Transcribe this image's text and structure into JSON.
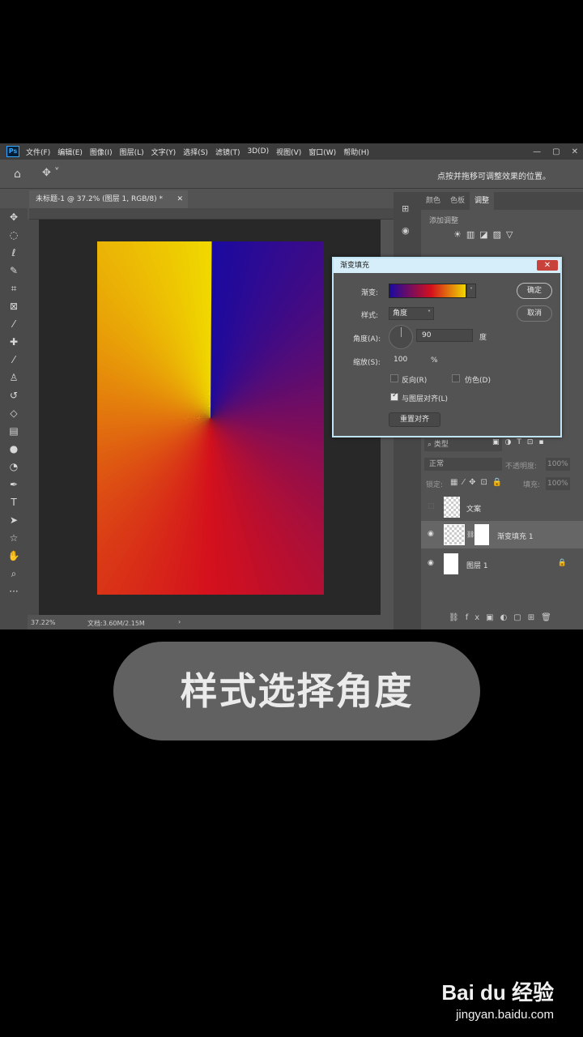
{
  "menubar": {
    "logo": "Ps",
    "items": [
      "文件(F)",
      "编辑(E)",
      "图像(I)",
      "图层(L)",
      "文字(Y)",
      "选择(S)",
      "滤镜(T)",
      "3D(D)",
      "视图(V)",
      "窗口(W)",
      "帮助(H)"
    ]
  },
  "options": {
    "hint": "点按并拖移可调整效果的位置。"
  },
  "document": {
    "tab": "未标题-1 @ 37.2% (图层 1, RGB/8) *",
    "zoom": "37.22%",
    "doc_size": "文档:3.60M/2.15M"
  },
  "panels": {
    "tabs": [
      "颜色",
      "色板",
      "调整"
    ],
    "adjustments_label": "添加调整",
    "search_kind": "类型",
    "blend_mode": "正常",
    "opacity_label": "不透明度:",
    "opacity_value": "100%",
    "lock_label": "锁定:",
    "fill_label": "填充:",
    "fill_value": "100%"
  },
  "layers": [
    {
      "name": "文案",
      "visible": false
    },
    {
      "name": "渐变填充 1",
      "visible": true
    },
    {
      "name": "图层 1",
      "visible": true
    }
  ],
  "dialog": {
    "title": "渐变填充",
    "gradient_label": "渐变:",
    "style_label": "样式:",
    "style_value": "角度",
    "angle_label": "角度(A):",
    "angle_value": "90",
    "angle_unit": "度",
    "scale_label": "缩放(S):",
    "scale_value": "100",
    "scale_unit": "%",
    "reverse_label": "反向(R)",
    "reverse_checked": false,
    "dither_label": "仿色(D)",
    "dither_checked": false,
    "align_label": "与图层对齐(L)",
    "align_checked": true,
    "reset_label": "重置对齐",
    "ok_label": "确定",
    "cancel_label": "取消",
    "close": "✕"
  },
  "caption": "样式选择角度",
  "watermark": {
    "logo": "Bai du 经验",
    "url": "jingyan.baidu.com"
  },
  "colors": {
    "gradient_start": "#1a0aa0",
    "gradient_mid": "#d4101c",
    "gradient_end": "#f0d800"
  }
}
